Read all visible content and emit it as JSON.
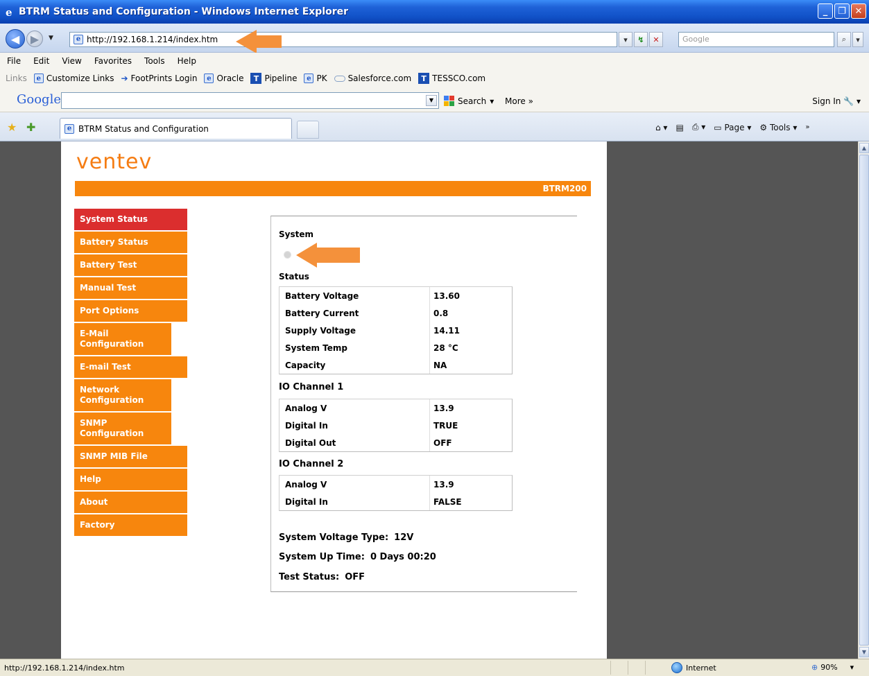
{
  "window": {
    "title": "BTRM Status and Configuration - Windows Internet Explorer"
  },
  "address": {
    "url": "http://192.168.1.214/index.htm",
    "search_placeholder": "Google"
  },
  "menu": [
    "File",
    "Edit",
    "View",
    "Favorites",
    "Tools",
    "Help"
  ],
  "links": {
    "label": "Links",
    "items": [
      "Customize Links",
      "FootPrints Login",
      "Oracle",
      "Pipeline",
      "PK",
      "Salesforce.com",
      "TESSCO.com"
    ]
  },
  "google_toolbar": {
    "logo": "Google",
    "search_label": "Search",
    "more_label": "More »",
    "sign_in": "Sign In"
  },
  "tab": {
    "title": "BTRM Status and Configuration"
  },
  "command_bar": {
    "page_label": "Page",
    "tools_label": "Tools"
  },
  "site": {
    "logo": "ventev",
    "model": "BTRM200",
    "nav": [
      "System Status",
      "Battery Status",
      "Battery Test",
      "Manual Test",
      "Port Options",
      "E-Mail Configuration",
      "E-mail Test",
      "Network Configuration",
      "SNMP Configuration",
      "SNMP MIB File",
      "Help",
      "About",
      "Factory"
    ],
    "active_nav": "System Status"
  },
  "panel": {
    "system_heading": "System",
    "status_heading": "Status",
    "status_rows": [
      {
        "label": "Battery Voltage",
        "value": "13.60"
      },
      {
        "label": "Battery Current",
        "value": "0.8"
      },
      {
        "label": "Supply Voltage",
        "value": "14.11"
      },
      {
        "label": "System Temp",
        "value": "28 °C"
      },
      {
        "label": "Capacity",
        "value": "NA"
      }
    ],
    "io1_heading": "IO Channel 1",
    "io1_rows": [
      {
        "label": "Analog V",
        "value": "13.9"
      },
      {
        "label": "Digital In",
        "value": "TRUE"
      },
      {
        "label": "Digital Out",
        "value": "OFF"
      }
    ],
    "io2_heading": "IO Channel 2",
    "io2_rows": [
      {
        "label": "Analog V",
        "value": "13.9"
      },
      {
        "label": "Digital In",
        "value": "FALSE"
      }
    ],
    "voltage_type_label": "System Voltage Type:",
    "voltage_type_value": "12V",
    "uptime_label": "System Up Time:",
    "uptime_value": "0 Days 00:20",
    "test_status_label": "Test Status:",
    "test_status_value": "OFF"
  },
  "statusbar": {
    "url": "http://192.168.1.214/index.htm",
    "zone": "Internet",
    "zoom": "90%"
  },
  "colors": {
    "accent_orange": "#f7860d",
    "active_red": "#db2e2e",
    "annotation_arrow": "#f4913b"
  }
}
